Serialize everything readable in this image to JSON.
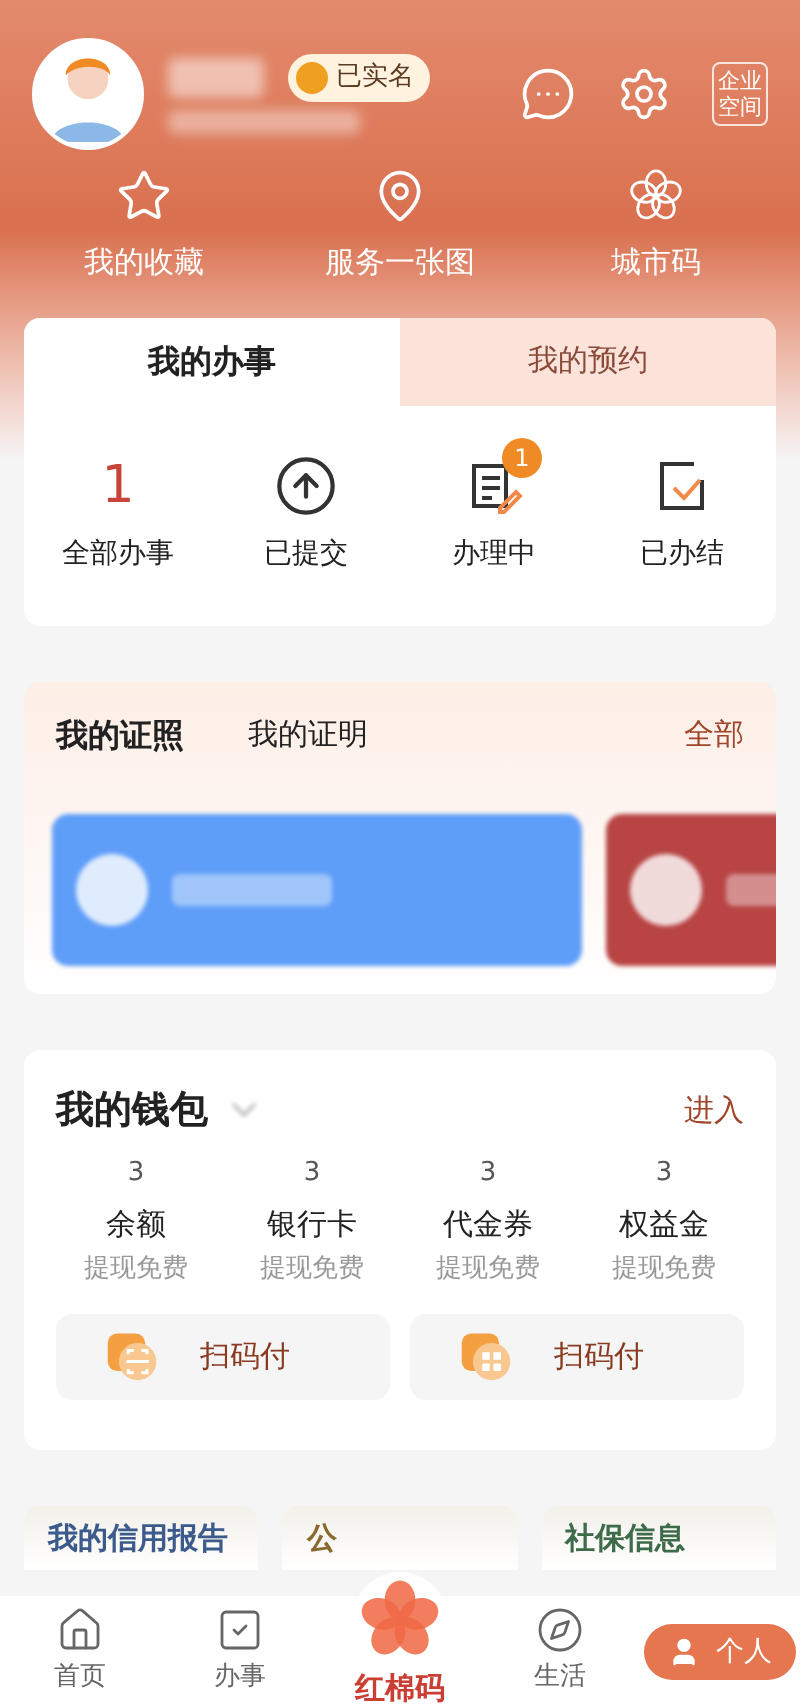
{
  "profile": {
    "verified_badge": "已实名"
  },
  "header_icons": [
    {
      "kind": "chat"
    },
    {
      "kind": "settings"
    },
    {
      "kind": "enterprise",
      "label": "企业空间"
    }
  ],
  "shortcuts": [
    {
      "kind": "star",
      "label": "我的收藏"
    },
    {
      "kind": "pin",
      "label": "服务一张图"
    },
    {
      "kind": "flower",
      "label": "城市码"
    }
  ],
  "affairs": {
    "tabs": [
      {
        "label": "我的办事",
        "selected": true
      },
      {
        "label": "我的预约",
        "selected": false
      }
    ],
    "items": [
      {
        "kind": "count",
        "count": "1",
        "label": "全部办事"
      },
      {
        "kind": "submitted",
        "label": "已提交"
      },
      {
        "kind": "processing",
        "label": "办理中",
        "badge": "1"
      },
      {
        "kind": "done",
        "label": "已办结"
      }
    ]
  },
  "certificates": {
    "tabs": [
      {
        "label": "我的证照",
        "selected": true
      },
      {
        "label": "我的证明",
        "selected": false
      }
    ],
    "more": "全部",
    "cards": [
      {
        "color": "#5f9ef8"
      },
      {
        "color": "#b84444"
      }
    ]
  },
  "wallet": {
    "title": "我的钱包",
    "enter": "进入",
    "items": [
      {
        "value": "3",
        "label": "余额",
        "note": "提现免费"
      },
      {
        "value": "3",
        "label": "银行卡",
        "note": "提现免费"
      },
      {
        "value": "3",
        "label": "代金券",
        "note": "提现免费"
      },
      {
        "value": "3",
        "label": "权益金",
        "note": "提现免费"
      }
    ],
    "pay_buttons": [
      {
        "kind": "scan",
        "label": "扫码付"
      },
      {
        "kind": "grid",
        "label": "扫码付"
      }
    ]
  },
  "services": [
    {
      "label": "我的信用报告",
      "color": "#3c5a8c"
    },
    {
      "label": "公",
      "color": "#8a6a2c"
    },
    {
      "label": "社保信息",
      "color": "#3e6b4a"
    }
  ],
  "nav": [
    {
      "kind": "home",
      "label": "首页",
      "selected": false
    },
    {
      "kind": "task",
      "label": "办事",
      "selected": false
    },
    {
      "kind": "center",
      "label": "红棉码",
      "selected": false
    },
    {
      "kind": "life",
      "label": "生活",
      "selected": false
    },
    {
      "kind": "person",
      "label": "个人",
      "selected": true
    }
  ]
}
